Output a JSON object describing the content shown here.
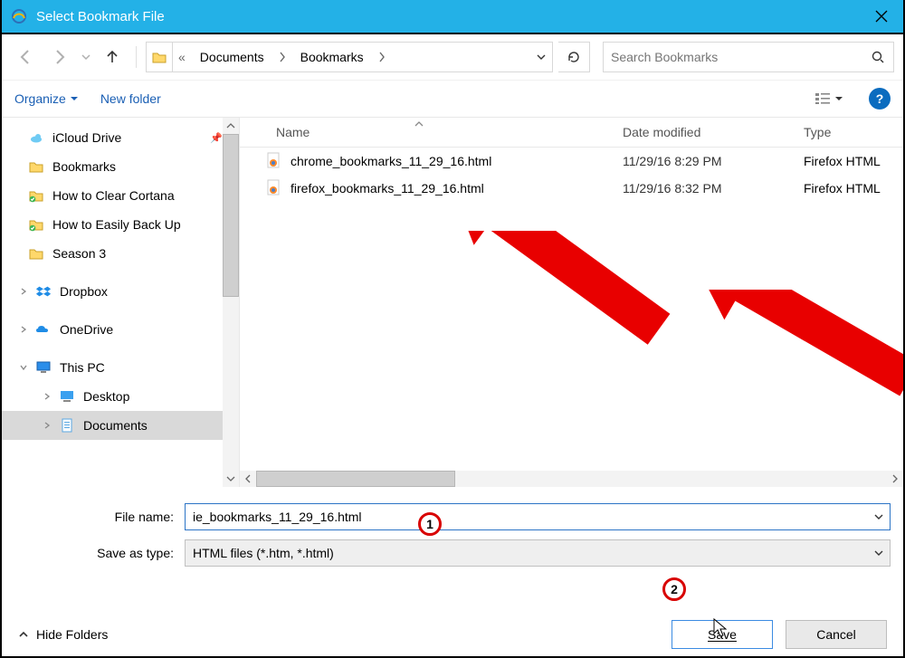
{
  "title": "Select Bookmark File",
  "breadcrumb": {
    "prefix": "«",
    "seg1": "Documents",
    "seg2": "Bookmarks"
  },
  "search": {
    "placeholder": "Search Bookmarks"
  },
  "toolbar": {
    "organize": "Organize",
    "newfolder": "New folder"
  },
  "columns": {
    "name": "Name",
    "date": "Date modified",
    "type": "Type"
  },
  "tree": {
    "icloud": "iCloud Drive",
    "bookmarks": "Bookmarks",
    "cortana": "How to Clear Cortana",
    "backup": "How to Easily Back Up",
    "season": "Season 3",
    "dropbox": "Dropbox",
    "onedrive": "OneDrive",
    "thispc": "This PC",
    "desktop": "Desktop",
    "documents": "Documents"
  },
  "files": [
    {
      "name": "chrome_bookmarks_11_29_16.html",
      "date": "11/29/16 8:29 PM",
      "type": "Firefox HTML"
    },
    {
      "name": "firefox_bookmarks_11_29_16.html",
      "date": "11/29/16 8:32 PM",
      "type": "Firefox HTML"
    }
  ],
  "form": {
    "filename_label": "File name:",
    "filename_value": "ie_bookmarks_11_29_16.html",
    "type_label": "Save as type:",
    "type_value": "HTML files (*.htm, *.html)"
  },
  "footer": {
    "hide": "Hide Folders",
    "save": "Save",
    "cancel": "Cancel"
  },
  "annotations": {
    "one": "1",
    "two": "2"
  }
}
